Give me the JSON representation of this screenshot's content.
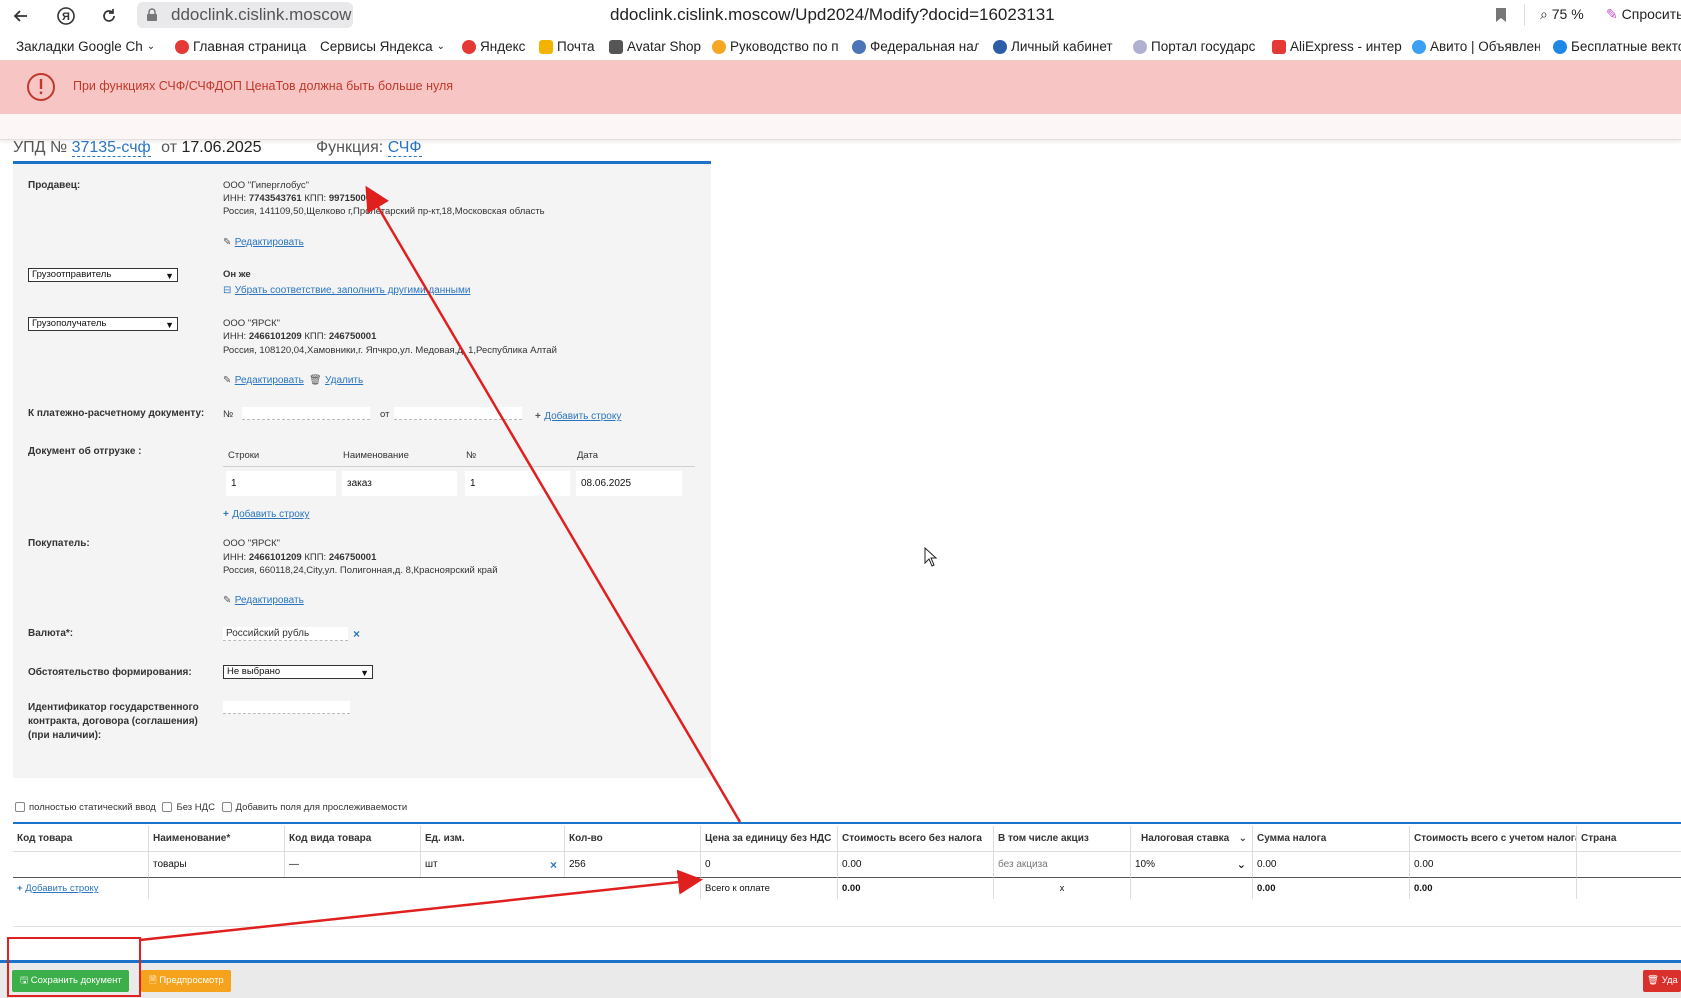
{
  "browser": {
    "host": "ddoclink.cislink.moscow",
    "url": "ddoclink.cislink.moscow/Upd2024/Modify?docid=16023131",
    "zoom": "75 %",
    "ask_label": "Спросить",
    "bookmarks": [
      {
        "label": "Закладки Google Ch",
        "color": "#f2b400"
      },
      {
        "label": "Главная страница",
        "color": "#e53935"
      },
      {
        "label": "Сервисы Яндекса",
        "color": ""
      },
      {
        "label": "Яндекс",
        "color": "#e53935"
      },
      {
        "label": "Почта",
        "color": "#f2b400"
      },
      {
        "label": "Avatar Shop",
        "color": "#555555"
      },
      {
        "label": "Руководство по п",
        "color": "#f5a623"
      },
      {
        "label": "Федеральная нал",
        "color": "#4a76b8"
      },
      {
        "label": "Личный кабинет",
        "color": "#2f5ea8"
      },
      {
        "label": "Портал государс",
        "color": "#b0b0d0"
      },
      {
        "label": "AliExpress - интер",
        "color": "#e53935"
      },
      {
        "label": "Авито | Объявлен",
        "color": "#3aa0f5"
      },
      {
        "label": "Бесплатные векто",
        "color": "#1e88e5"
      }
    ]
  },
  "alert": {
    "message": "При функциях СЧФ/СЧФДОП ЦенаТов должна быть больше нуля",
    "color": "#c0392b"
  },
  "header": {
    "prefix": "УПД №",
    "number": "37135-счф",
    "from_label": "от",
    "date": "17.06.2025",
    "function_label": "Функция:",
    "function_value": "СЧФ"
  },
  "seller": {
    "label": "Продавец:",
    "name": "ООО \"Гиперглобус\"",
    "inn_label": "ИНН:",
    "inn": "7743543761",
    "kpp_label": "КПП:",
    "kpp": "997150001",
    "address": "Россия, 141109,50,Щелково г,Пролетарский пр-кт,18,Московская область",
    "edit_label": "Редактировать"
  },
  "shipper": {
    "select_value": "Грузоотправитель",
    "same_label": "Он же",
    "remove_link": "Убрать соответствие, заполнить другими данными"
  },
  "consignee": {
    "select_value": "Грузополучатель",
    "name": "ООО \"ЯРСК\"",
    "inn_label": "ИНН:",
    "inn": "2466101209",
    "kpp_label": "КПП:",
    "kpp": "246750001",
    "address": "Россия, 108120,04,Хамовники,г. Япчкро,ул. Медовая,д. 1,Республика Алтай",
    "edit_label": "Редактировать",
    "delete_label": "Удалить"
  },
  "payment_doc": {
    "label": "К платежно-расчетному документу:",
    "num_label": "№",
    "from_label": "от",
    "add_label": "Добавить строку"
  },
  "shipment_doc": {
    "label": "Документ об отгрузке :",
    "columns": [
      "Строки",
      "Наименование",
      "№",
      "Дата"
    ],
    "row": [
      "1",
      "заказ",
      "1",
      "08.06.2025"
    ],
    "add_label": "Добавить строку"
  },
  "buyer": {
    "label": "Покупатель:",
    "name": "ООО \"ЯРСК\"",
    "inn_label": "ИНН:",
    "inn": "2466101209",
    "kpp_label": "КПП:",
    "kpp": "246750001",
    "address": "Россия, 660118,24,City,ул. Полигонная,д. 8,Красноярский край",
    "edit_label": "Редактировать"
  },
  "currency": {
    "label": "Валюта*:",
    "value": "Российский рубль"
  },
  "circumstance": {
    "label": "Обстоятельство формирования:",
    "value": "Не выбрано"
  },
  "gov_contract": {
    "label_line1": "Идентификатор государственного",
    "label_line2": "контракта, договора (соглашения)",
    "label_line3": "(при наличии):"
  },
  "options": {
    "static_input": "полностью статический ввод",
    "no_vat": "Без НДС",
    "traceability": "Добавить поля для прослеживаемости"
  },
  "items": {
    "columns": [
      "Код товара",
      "Наименование*",
      "Код вида товара",
      "Ед. изм.",
      "Кол-во",
      "Цена за единицу без НДС",
      "Стоимость всего без налога",
      "В том числе акциз",
      "Налоговая ставка",
      "Сумма налога",
      "Стоимость всего с учетом налога",
      "Страна"
    ],
    "row": {
      "code": "",
      "name": "товары",
      "kind_code": "—",
      "unit": "шт",
      "qty": "256",
      "price": "0",
      "cost_no_tax": "0.00",
      "excise": "без акциза",
      "tax_rate": "10%",
      "tax_sum": "0.00",
      "cost_with_tax": "0.00",
      "country": ""
    },
    "add_label": "Добавить строку",
    "total_label": "Всего к оплате",
    "total_cost_no_tax": "0.00",
    "total_excise": "x",
    "total_tax_sum": "0.00",
    "total_cost_with_tax": "0.00"
  },
  "footer": {
    "save_label": "Сохранить документ",
    "preview_label": "Предпросмотр",
    "delete_label": "Уда",
    "save_color": "#3cae4a",
    "preview_color": "#f5a31c",
    "delete_color": "#d9302c"
  }
}
